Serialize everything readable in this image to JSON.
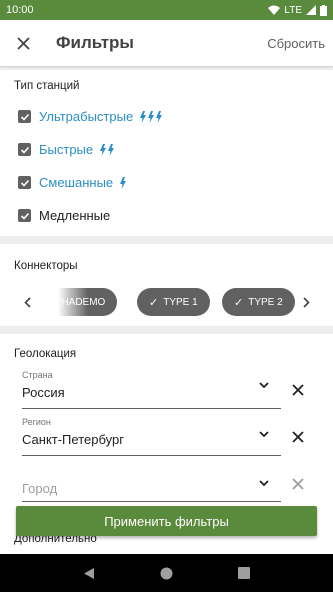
{
  "status_bar": {
    "time": "10:00",
    "network": "LTE"
  },
  "toolbar": {
    "title": "Фильтры",
    "reset_label": "Сбросить"
  },
  "station_types": {
    "title": "Тип станций",
    "items": [
      {
        "label": "Ультрабыстрые",
        "checked": true,
        "bolts": 3
      },
      {
        "label": "Быстрые",
        "checked": true,
        "bolts": 2
      },
      {
        "label": "Смешанные",
        "checked": true,
        "bolts": 1
      },
      {
        "label": "Медленные",
        "checked": true,
        "bolts": 0
      }
    ]
  },
  "connectors": {
    "title": "Коннекторы",
    "chips": [
      {
        "label": "CHADEMO",
        "selected": true
      },
      {
        "label": "TYPE 1",
        "selected": true
      },
      {
        "label": "TYPE 2",
        "selected": true
      }
    ]
  },
  "geolocation": {
    "title": "Геолокация",
    "country": {
      "label": "Страна",
      "value": "Россия"
    },
    "region": {
      "label": "Регион",
      "value": "Санкт-Петербург"
    },
    "city": {
      "placeholder": "Город"
    }
  },
  "additional": {
    "title": "Дополнительно"
  },
  "apply_button": {
    "label": "Применить фильтры"
  },
  "colors": {
    "accent": "#5a8a3c",
    "link": "#2b8fc6",
    "chip": "#616161"
  }
}
